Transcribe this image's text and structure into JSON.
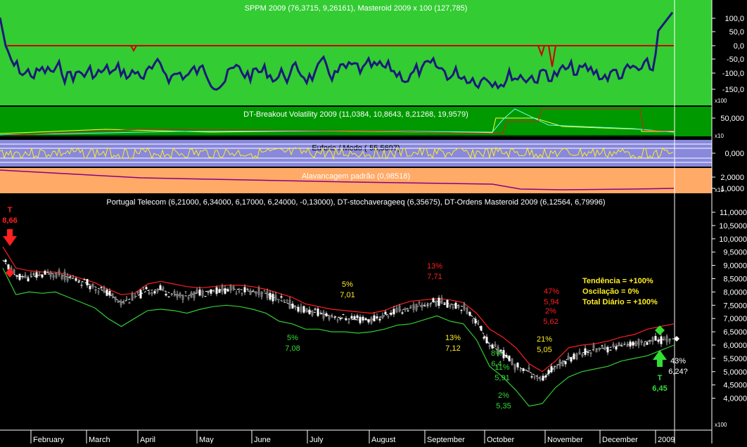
{
  "colors": {
    "background": "#000000",
    "panel1_bg": "#33cc33",
    "panel2_bg": "#009900",
    "panel3_bg": "#8888dd",
    "panel4_bg": "#ffaa66",
    "accent_red": "#ff2020",
    "accent_green": "#33dd33",
    "accent_yellow": "#ffee22"
  },
  "panels": [
    {
      "title": "SPPM 2009 (76,3715, 9,26161), Masteroid 2009 x 100 (127,785)",
      "ticks": [
        "100,0",
        "50,0",
        "0,0",
        "-50,0",
        "-100,0",
        "-150,0"
      ],
      "unit": "x100"
    },
    {
      "title": "DT-Breakout Volatility 2009 (11,0384, 10,8643, 8,21268, 19,9579)",
      "ticks": [
        "50,000"
      ],
      "unit": "x10"
    },
    {
      "title": "Euforia / Medo (-55,5697)",
      "ticks": [
        "0,000"
      ]
    },
    {
      "title": "Alavancagem padrão (0,98518)",
      "ticks": [
        "2,0000",
        "1,0000"
      ],
      "unit": "x10"
    }
  ],
  "chart_data": {
    "type": "line",
    "title": "Portugal Telecom (6,21000, 6,34000, 6,17000, 6,24000, -0,13000), DT-stochaverageeq (6,35675), DT-Ordens Masteroid 2009 (6,12564, 6,79996)",
    "x_months": [
      "February",
      "March",
      "April",
      "May",
      "June",
      "July",
      "August",
      "September",
      "October",
      "November",
      "December",
      "2009"
    ],
    "y_ticks": [
      "11,0000",
      "10,5000",
      "10,0000",
      "9,5000",
      "9,0000",
      "8,5000",
      "8,0000",
      "7,5000",
      "7,0000",
      "6,5000",
      "6,0000",
      "5,5000",
      "5,0000",
      "4,5000",
      "4,0000"
    ],
    "ylim": [
      3.5,
      11.2
    ],
    "y_unit": "x100",
    "series": [
      {
        "values": [
          9.2,
          8.6,
          8.55,
          8.65,
          8.7,
          8.55,
          8.4,
          8.2,
          7.95,
          7.6,
          7.8,
          8.05,
          8.1,
          7.9,
          7.85,
          8.0,
          8.05,
          8.1,
          8.1,
          8.0,
          7.95,
          7.7,
          7.5,
          7.3,
          7.2,
          7.1,
          7.0,
          6.95,
          6.95,
          7.1,
          7.3,
          7.4,
          7.5,
          7.65,
          7.55,
          7.45,
          6.9,
          6.0,
          5.7,
          5.2,
          5.0,
          4.7,
          5.2,
          5.5,
          5.7,
          5.85,
          5.9,
          6.0,
          6.05,
          6.15,
          6.2,
          6.24
        ]
      },
      {
        "values": [
          9.7,
          8.9,
          8.8,
          8.75,
          8.75,
          8.65,
          8.5,
          8.35,
          8.1,
          7.9,
          7.95,
          8.3,
          8.4,
          8.3,
          8.2,
          8.15,
          8.2,
          8.25,
          8.25,
          8.2,
          8.1,
          7.95,
          7.8,
          7.55,
          7.45,
          7.35,
          7.3,
          7.25,
          7.2,
          7.3,
          7.5,
          7.65,
          7.7,
          7.75,
          7.7,
          7.6,
          7.2,
          6.6,
          6.3,
          5.9,
          5.3,
          5.0,
          5.4,
          5.9,
          6.0,
          6.05,
          6.15,
          6.3,
          6.4,
          6.6,
          6.7,
          6.8
        ]
      },
      {
        "values": [
          8.9,
          7.9,
          8.0,
          7.95,
          8.0,
          7.8,
          7.6,
          7.4,
          7.0,
          6.7,
          7.0,
          7.3,
          7.35,
          7.3,
          7.2,
          7.35,
          7.45,
          7.5,
          7.45,
          7.35,
          7.2,
          6.9,
          6.8,
          6.6,
          6.6,
          6.5,
          6.5,
          6.45,
          6.5,
          6.6,
          6.75,
          6.8,
          6.95,
          7.1,
          6.9,
          6.8,
          6.2,
          5.2,
          4.8,
          4.3,
          3.7,
          3.8,
          4.4,
          4.8,
          5.0,
          5.1,
          5.2,
          5.4,
          5.5,
          5.6,
          5.8,
          6.0
        ]
      }
    ],
    "annotations": [
      {
        "label": "T",
        "value": "8,66",
        "color": "red"
      },
      {
        "label": "5%",
        "value": "7,01",
        "color": "yellow"
      },
      {
        "label": "13%",
        "value": "7,71",
        "color": "red"
      },
      {
        "label": "5%",
        "value": "7,08",
        "color": "green"
      },
      {
        "label": "13%",
        "value": "7,12",
        "color": "yellow"
      },
      {
        "label": "47%",
        "value": "5,94",
        "color": "red"
      },
      {
        "label": "2%",
        "value": "5,62",
        "color": "red"
      },
      {
        "label": "21%",
        "value": "5,05",
        "color": "yellow"
      },
      {
        "label": "8%",
        "value": "6,4",
        "color": "green"
      },
      {
        "label": "11%",
        "value": "5,91",
        "color": "green"
      },
      {
        "label": "2%",
        "value": "5,35",
        "color": "green"
      },
      {
        "label": "43%",
        "value": "6,24?",
        "color": "white"
      },
      {
        "label": "T",
        "value": "6,45",
        "color": "green"
      }
    ],
    "summary": [
      "Tendência = +100%",
      "Oscilação = 0%",
      "Total Diário = +100%"
    ]
  }
}
